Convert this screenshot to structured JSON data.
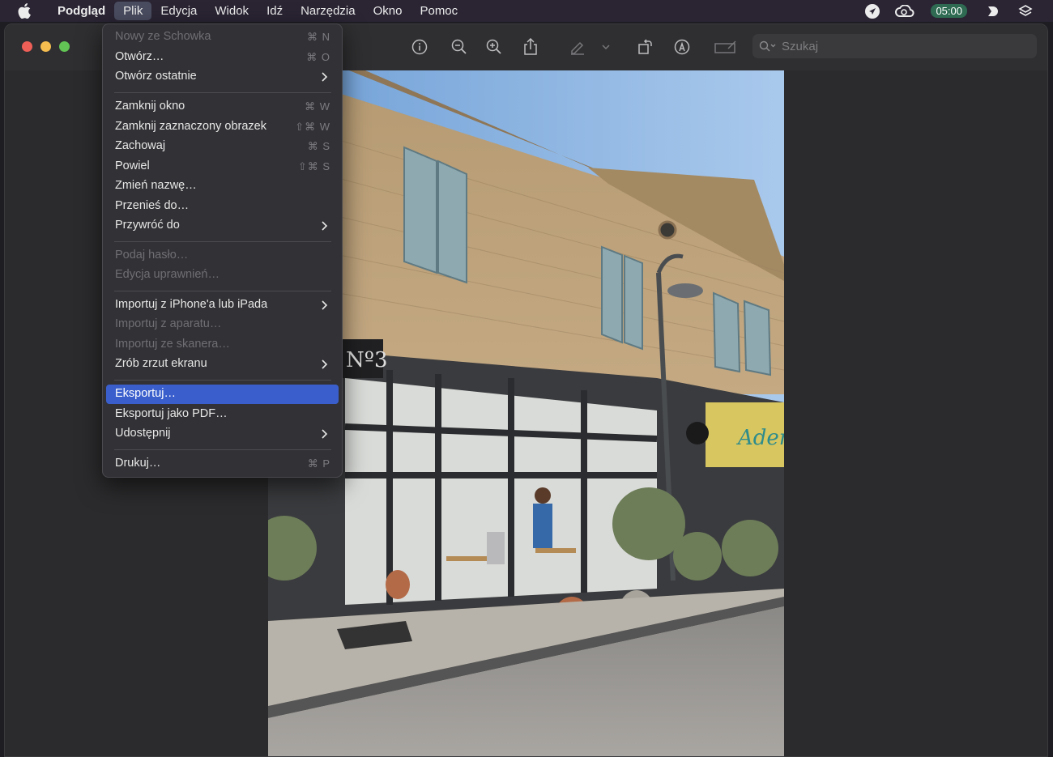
{
  "menubar": {
    "items": [
      {
        "label": "Podgląd",
        "bold": true
      },
      {
        "label": "Plik",
        "active": true
      },
      {
        "label": "Edycja"
      },
      {
        "label": "Widok"
      },
      {
        "label": "Idź"
      },
      {
        "label": "Narzędzia"
      },
      {
        "label": "Okno"
      },
      {
        "label": "Pomoc"
      }
    ],
    "timer": "05:00",
    "status_icons": [
      "location-arrow-icon",
      "creative-cloud-icon",
      "timer-badge",
      "arc-browser-icon",
      "layers-icon"
    ]
  },
  "toolbar": {
    "search_placeholder": "Szukaj",
    "icons": [
      "info-icon",
      "zoom-out-icon",
      "zoom-in-icon",
      "share-icon",
      "markup-pen-icon",
      "chevron-down-icon",
      "rotate-icon",
      "markup-icon",
      "annotate-icon"
    ]
  },
  "file_menu": {
    "items": [
      {
        "label": "Nowy ze Schowka",
        "shortcut": "⌘ N",
        "disabled": true
      },
      {
        "label": "Otwórz…",
        "shortcut": "⌘ O"
      },
      {
        "label": "Otwórz ostatnie",
        "submenu": true
      },
      {
        "label": "Zamknij okno",
        "shortcut": "⌘ W"
      },
      {
        "label": "Zamknij zaznaczony obrazek",
        "shortcut": "⇧⌘ W"
      },
      {
        "label": "Zachowaj",
        "shortcut": "⌘ S"
      },
      {
        "label": "Powiel",
        "shortcut": "⇧⌘ S"
      },
      {
        "label": "Zmień nazwę…"
      },
      {
        "label": "Przenieś do…"
      },
      {
        "label": "Przywróć do",
        "submenu": true
      },
      {
        "label": "Podaj hasło…",
        "disabled": true
      },
      {
        "label": "Edycja uprawnień…",
        "disabled": true
      },
      {
        "label": "Importuj z iPhone'a lub iPada",
        "submenu": true
      },
      {
        "label": "Importuj z aparatu…",
        "disabled": true
      },
      {
        "label": "Importuj ze skanera…",
        "disabled": true
      },
      {
        "label": "Zrób zrzut ekranu",
        "submenu": true
      },
      {
        "label": "Eksportuj…",
        "highlighted": true
      },
      {
        "label": "Eksportuj jako PDF…"
      },
      {
        "label": "Udostępnij",
        "submenu": true
      },
      {
        "label": "Drukuj…",
        "shortcut": "⌘ P"
      }
    ]
  },
  "photo": {
    "sign_no3": "Nº3",
    "sign_adem": "Adem"
  },
  "colors": {
    "menubar_bg": "#2a2433",
    "menu_bg": "#323236",
    "highlight": "#3a5fcd",
    "timer_bg": "#2e6b52",
    "traffic_red": "#ed5f57",
    "traffic_yellow": "#f5bd4f",
    "traffic_green": "#61c454"
  }
}
